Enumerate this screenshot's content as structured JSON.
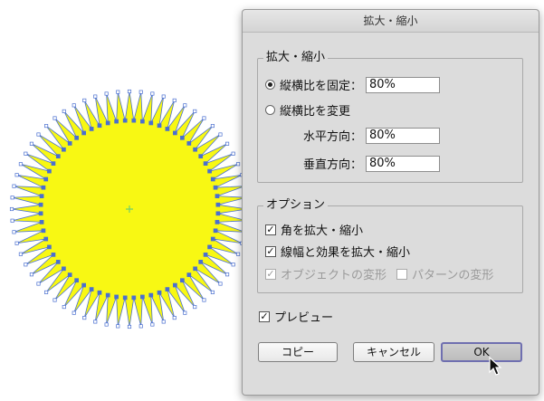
{
  "dialog": {
    "title": "拡大・縮小",
    "scale_group": {
      "title": "拡大・縮小",
      "uniform_label": "縦横比を固定：",
      "uniform_value": "80%",
      "uniform_selected": true,
      "nonuniform_label": "縦横比を変更",
      "horizontal_label": "水平方向：",
      "horizontal_value": "80%",
      "vertical_label": "垂直方向：",
      "vertical_value": "80%"
    },
    "options_group": {
      "title": "オプション",
      "scale_corners": {
        "label": "角を拡大・縮小",
        "checked": true
      },
      "scale_strokes": {
        "label": "線幅と効果を拡大・縮小",
        "checked": true
      },
      "transform_objects": {
        "label": "オブジェクトの変形",
        "checked": true,
        "enabled": false
      },
      "transform_patterns": {
        "label": "パターンの変形",
        "checked": false,
        "enabled": false
      }
    },
    "preview": {
      "label": "プレビュー",
      "checked": true
    },
    "buttons": {
      "copy": "コピー",
      "cancel": "キャンセル",
      "ok": "OK"
    }
  },
  "artwork": {
    "fill_color": "#f8f813",
    "selection_color": "#4a6fd0",
    "center_mark_color": "#6fd06f"
  }
}
